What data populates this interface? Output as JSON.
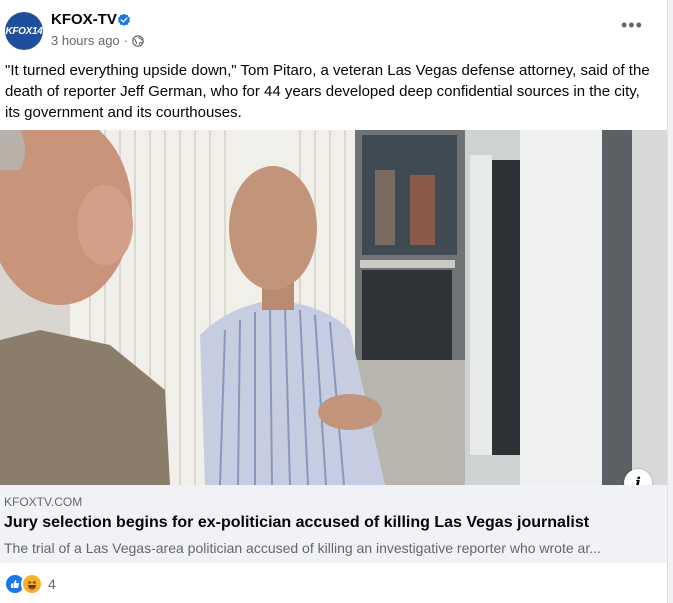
{
  "post": {
    "page_name": "KFOX-TV",
    "avatar_text": "KFOX14",
    "timestamp": "3 hours ago",
    "separator": "·",
    "more_label": "•••",
    "text": "\"It turned everything upside down,\" Tom Pitaro, a veteran Las Vegas defense attorney, said of the death of reporter Jeff German, who for 44 years developed deep confidential sources in the city, its government and its courthouses."
  },
  "link": {
    "domain": "KFOXTV.COM",
    "headline": "Jury selection begins for ex-politician accused of killing Las Vegas journalist",
    "description": "The trial of a Las Vegas-area politician accused of killing an investigative reporter who wrote ar...",
    "info_label": "i"
  },
  "reactions": {
    "types": [
      "like-icon",
      "haha-icon"
    ],
    "count": "4"
  },
  "colors": {
    "avatar": "#1f4f9c",
    "verified": "#1877f2",
    "like": "#1877f2",
    "haha": "#f7b125"
  }
}
